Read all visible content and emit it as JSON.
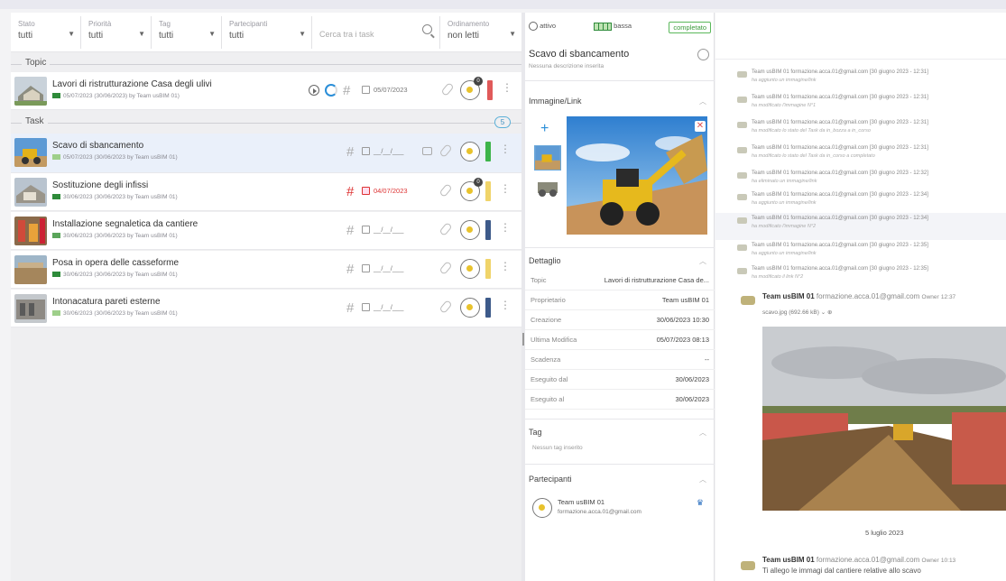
{
  "filters": [
    {
      "label": "Stato",
      "value": "tutti"
    },
    {
      "label": "Priorità",
      "value": "tutti"
    },
    {
      "label": "Tag",
      "value": "tutti"
    },
    {
      "label": "Partecipanti",
      "value": "tutti"
    }
  ],
  "search": {
    "placeholder": "Cerca tra i task"
  },
  "sort": {
    "label": "Ordinamento",
    "value": "non letti"
  },
  "sections": {
    "topic": "Topic",
    "task": "Task",
    "task_count": "5"
  },
  "topic": {
    "title": "Lavori di ristrutturazione Casa degli ulivi",
    "sub": "05/07/2023 (30/06/2023) by Team usBIM 01)",
    "date": "05/07/2023",
    "badge": "0",
    "color": "#e05a5a"
  },
  "tasks": [
    {
      "title": "Scavo di sbancamento",
      "sub": "05/07/2023 (30/06/2023 by Team usBIM 01)",
      "date": "__/__/___",
      "color": "#3db44a",
      "prio_color": "#9ecf8a"
    },
    {
      "title": "Sostituzione degli infissi",
      "sub": "30/06/2023 (30/06/2023 by Team usBIM 01)",
      "date": "04/07/2023",
      "color": "#f0d46a",
      "prio_color": "#2e8b3a",
      "badge": "0"
    },
    {
      "title": "Installazione segnaletica da cantiere",
      "sub": "30/06/2023 (30/06/2023 by Team usBIM 01)",
      "date": "__/__/___",
      "color": "#3d5a8a",
      "prio_color": "#5aa55a"
    },
    {
      "title": "Posa in opera delle casseforme",
      "sub": "30/06/2023 (30/06/2023 by Team usBIM 01)",
      "date": "__/__/___",
      "color": "#f0d46a",
      "prio_color": "#2e8b3a"
    },
    {
      "title": "Intonacatura pareti esterne",
      "sub": "30/06/2023 (30/06/2023 by Team usBIM 01)",
      "date": "__/__/___",
      "color": "#3d5a8a",
      "prio_color": "#9ecf8a"
    }
  ],
  "detail": {
    "status": "attivo",
    "priority": "bassa",
    "state_badge": "completato",
    "title": "Scavo di sbancamento",
    "description": "Nessuna descrizione inserita",
    "image_section": "Immagine/Link",
    "detail_section": "Dettaglio",
    "rows": [
      {
        "k": "Topic",
        "v": "Lavori di ristrutturazione Casa de..."
      },
      {
        "k": "Proprietario",
        "v": "Team usBIM 01"
      },
      {
        "k": "Creazione",
        "v": "30/06/2023 10:30"
      },
      {
        "k": "Ultima Modifica",
        "v": "05/07/2023 08:13"
      },
      {
        "k": "Scadenza",
        "v": "--"
      },
      {
        "k": "Eseguito dal",
        "v": "30/06/2023"
      },
      {
        "k": "Eseguito al",
        "v": "30/06/2023"
      }
    ],
    "tag_section": "Tag",
    "tag_empty": "Nessun tag inserito",
    "participants_section": "Partecipanti",
    "participant_name": "Team usBIM 01",
    "participant_email": "formazione.acca.01@gmail.com"
  },
  "activity": [
    {
      "who": "Team usBIM 01",
      "email": "formazione.acca.01@gmail.com",
      "when": "[30 giugno 2023 - 12:31]",
      "what": "ha aggiunto un immagine/link"
    },
    {
      "who": "Team usBIM 01",
      "email": "formazione.acca.01@gmail.com",
      "when": "[30 giugno 2023 - 12:31]",
      "what": "ha modificato l'immagine N°1"
    },
    {
      "who": "Team usBIM 01",
      "email": "formazione.acca.01@gmail.com",
      "when": "[30 giugno 2023 - 12:31]",
      "what": "ha modificato lo stato del Task da in_bozza a in_corso"
    },
    {
      "who": "Team usBIM 01",
      "email": "formazione.acca.01@gmail.com",
      "when": "[30 giugno 2023 - 12:31]",
      "what": "ha modificato lo stato del Task da in_corso a completato"
    },
    {
      "who": "Team usBIM 01",
      "email": "formazione.acca.01@gmail.com",
      "when": "[30 giugno 2023 - 12:32]",
      "what": "ha eliminato un immagine/link"
    },
    {
      "who": "Team usBIM 01",
      "email": "formazione.acca.01@gmail.com",
      "when": "[30 giugno 2023 - 12:34]",
      "what": "ha aggiunto un immagine/link"
    },
    {
      "who": "Team usBIM 01",
      "email": "formazione.acca.01@gmail.com",
      "when": "[30 giugno 2023 - 12:34]",
      "what": "ha modificato l'immagine N°2"
    },
    {
      "who": "Team usBIM 01",
      "email": "formazione.acca.01@gmail.com",
      "when": "[30 giugno 2023 - 12:35]",
      "what": "ha aggiunto un immagine/link"
    },
    {
      "who": "Team usBIM 01",
      "email": "formazione.acca.01@gmail.com",
      "when": "[30 giugno 2023 - 12:35]",
      "what": "ha modificato il link N°2"
    }
  ],
  "message1": {
    "who": "Team usBIM 01",
    "email": "formazione.acca.01@gmail.com",
    "role": "Owner",
    "time": "12:37",
    "file": "scavo.jpg (692.66 kB)"
  },
  "date_divider": "5 luglio 2023",
  "message2": {
    "who": "Team usBIM 01",
    "email": "formazione.acca.01@gmail.com",
    "role": "Owner",
    "time": "10:13",
    "text": "Ti allego le immagi dal cantiere relative allo scavo"
  }
}
